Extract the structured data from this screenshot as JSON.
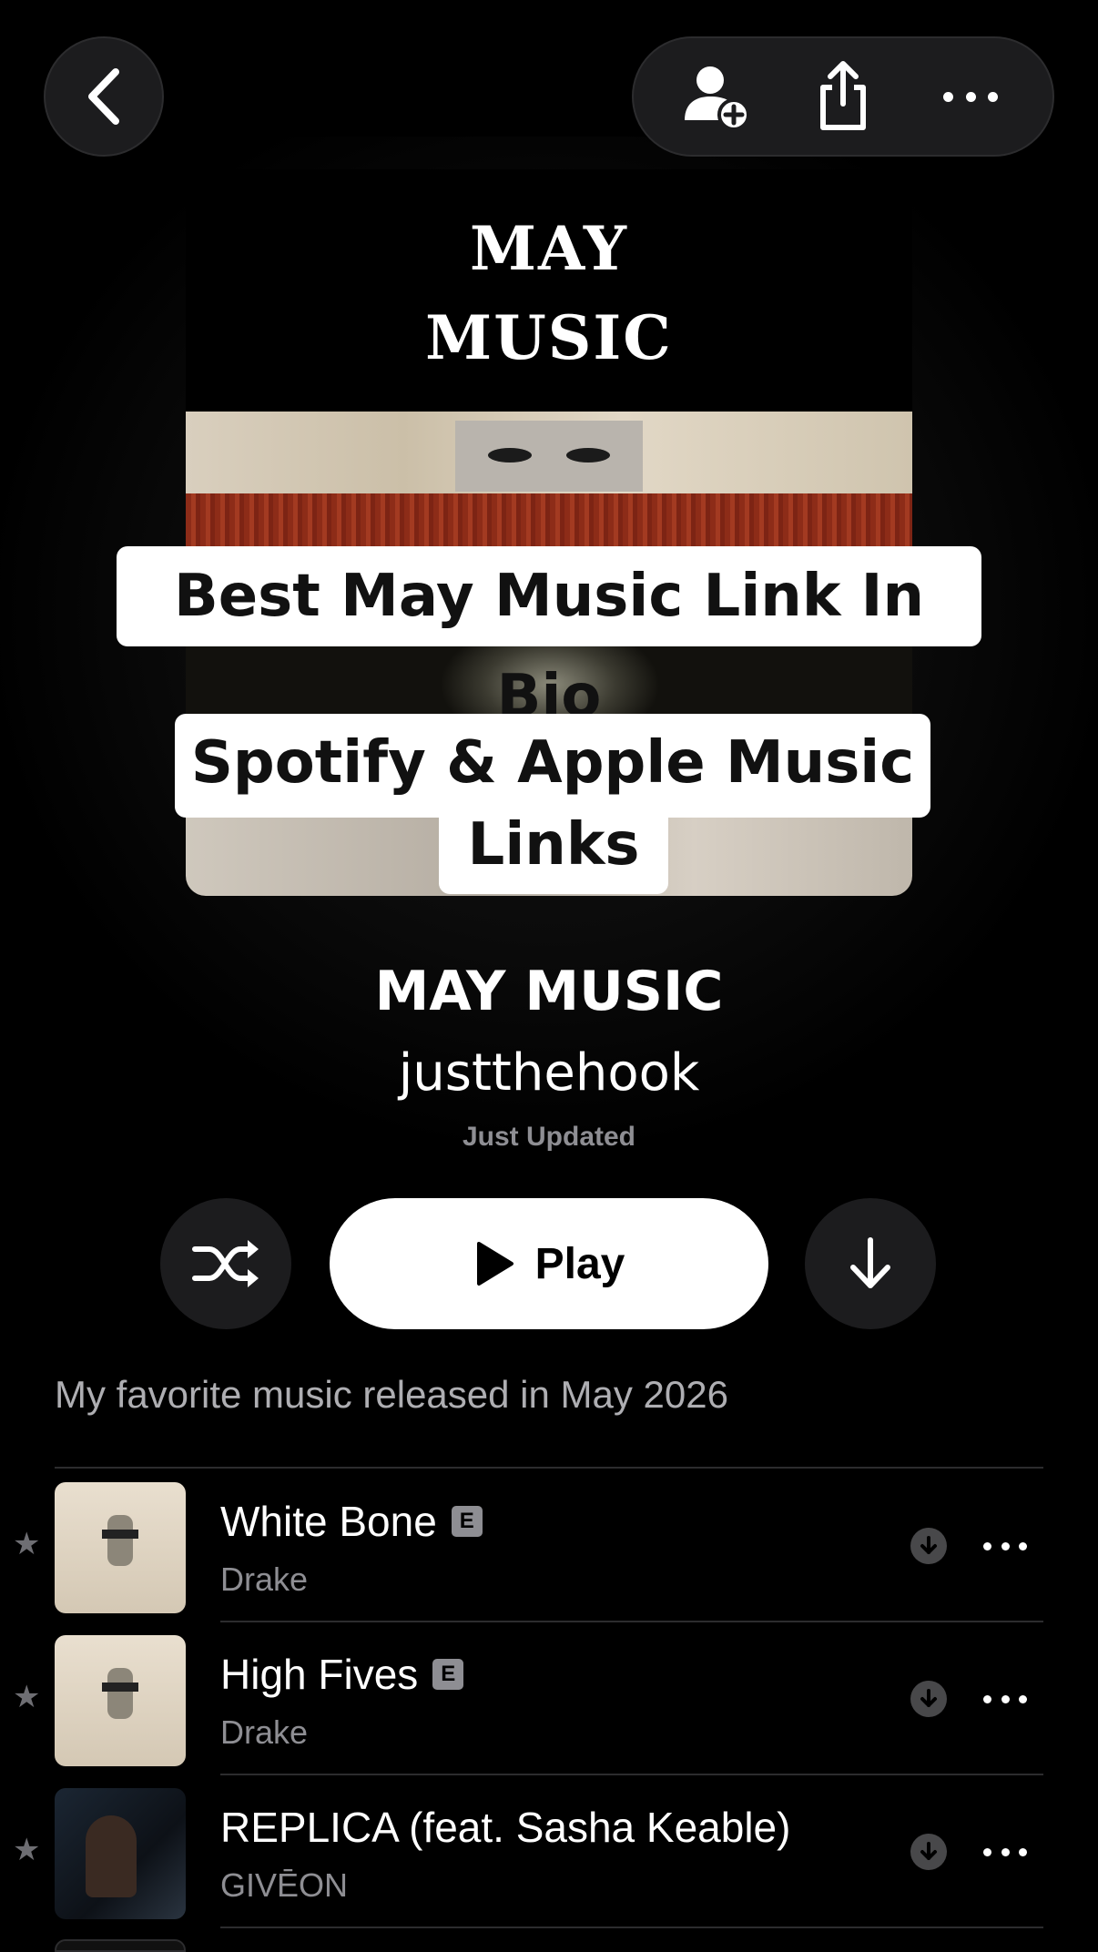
{
  "artwork": {
    "title_line1": "MAY",
    "title_line2": "MUSIC",
    "caption1": "Best May Music Link In Bio",
    "caption2_line1": "Spotify & Apple Music",
    "caption2_line2": "Links"
  },
  "playlist": {
    "title": "MAY MUSIC",
    "owner": "justthehook",
    "updated": "Just Updated",
    "description": "My favorite music released in May 2026"
  },
  "actions": {
    "play_label": "Play"
  },
  "tracks": [
    {
      "title": "White Bone",
      "artist": "Drake",
      "explicit": "E"
    },
    {
      "title": "High Fives",
      "artist": "Drake",
      "explicit": "E"
    },
    {
      "title": "REPLICA (feat. Sasha Keable)",
      "artist": "GIVĒON",
      "explicit": ""
    }
  ],
  "icons": {
    "back": "chevron-left-icon",
    "add_person": "person-add-icon",
    "share": "share-icon",
    "more": "ellipsis-icon",
    "shuffle": "shuffle-icon",
    "download": "download-arrow-icon",
    "play": "play-triangle-icon",
    "favorite": "star-icon"
  }
}
